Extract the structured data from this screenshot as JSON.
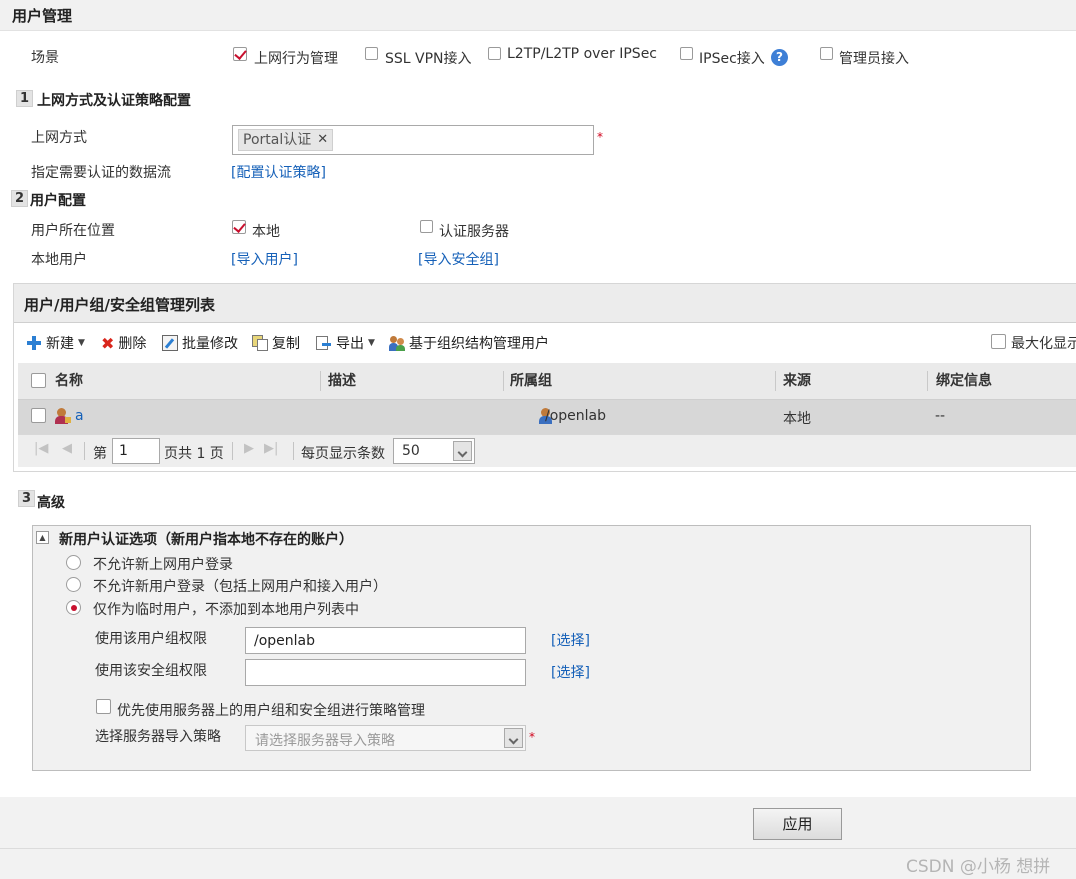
{
  "header": {
    "title": "用户管理"
  },
  "scene": {
    "label": "场景",
    "options": [
      {
        "label": "上网行为管理",
        "checked": true
      },
      {
        "label": "SSL VPN接入",
        "checked": false
      },
      {
        "label": "L2TP/L2TP over IPSec",
        "checked": false
      },
      {
        "label": "IPSec接入",
        "checked": false
      },
      {
        "label": "管理员接入",
        "checked": false
      }
    ]
  },
  "section1": {
    "num": "1",
    "title": "上网方式及认证策略配置",
    "access_label": "上网方式",
    "access_tag": "Portal认证",
    "required_mark": "*",
    "flow_label": "指定需要认证的数据流",
    "flow_link": "[配置认证策略]"
  },
  "section2": {
    "num": "2",
    "title": "用户配置",
    "location_label": "用户所在位置",
    "location_local": "本地",
    "location_server": "认证服务器",
    "local_user_label": "本地用户",
    "import_user_link": "[导入用户]",
    "import_secgroup_link": "[导入安全组]"
  },
  "list_panel": {
    "title": "用户/用户组/安全组管理列表",
    "toolbar": {
      "new": "新建",
      "delete": "删除",
      "batch_edit": "批量修改",
      "copy": "复制",
      "export": "导出",
      "org_manage": "基于组织结构管理用户",
      "maximize": "最大化显示"
    },
    "columns": [
      "名称",
      "描述",
      "所属组",
      "来源",
      "绑定信息"
    ],
    "rows": [
      {
        "name": "a",
        "desc": "",
        "group": "/openlab",
        "source": "本地",
        "binding": "--"
      }
    ],
    "pager": {
      "page_prefix": "第",
      "page_value": "1",
      "page_suffix": "页共 1 页",
      "per_page_label": "每页显示条数",
      "per_page_value": "50"
    }
  },
  "section3": {
    "num": "3",
    "title": "高级",
    "box_title": "新用户认证选项（新用户指本地不存在的账户）",
    "radios": [
      {
        "label": "不允许新上网用户登录",
        "selected": false
      },
      {
        "label": "不允许新用户登录（包括上网用户和接入用户）",
        "selected": false
      },
      {
        "label": "仅作为临时用户，不添加到本地用户列表中",
        "selected": true
      }
    ],
    "usergroup_label": "使用该用户组权限",
    "usergroup_value": "/openlab",
    "secgroup_label": "使用该安全组权限",
    "secgroup_value": "",
    "choose_link": "[选择]",
    "prefer_server_label": "优先使用服务器上的用户组和安全组进行策略管理",
    "import_policy_label": "选择服务器导入策略",
    "import_policy_placeholder": "请选择服务器导入策略",
    "required_mark": "*"
  },
  "footer": {
    "apply": "应用",
    "watermark": "CSDN @小杨 想拼"
  },
  "colors": {
    "accent_red": "#c8102e",
    "link_blue": "#1560b8"
  }
}
